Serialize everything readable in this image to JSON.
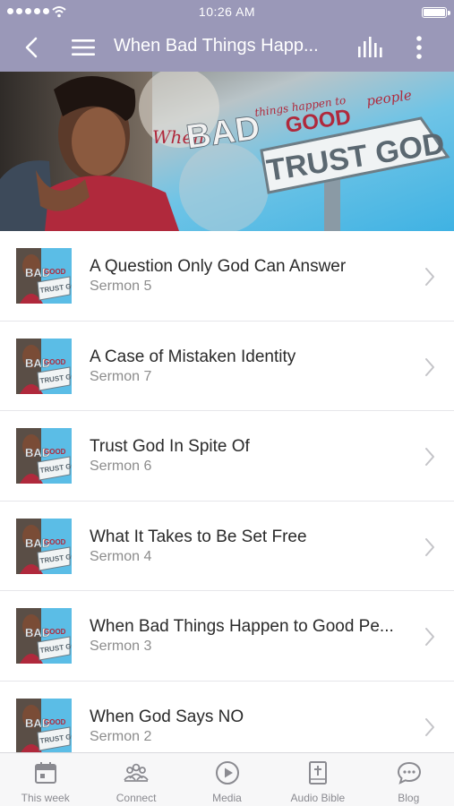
{
  "status_bar": {
    "time": "10:26 AM"
  },
  "header": {
    "title": "When Bad Things Happ..."
  },
  "banner": {
    "when": "When",
    "bad": "BAD",
    "things_happen": "things happen to",
    "good": "GOOD",
    "people": "people",
    "trust_god": "TRUST GOD"
  },
  "thumb": {
    "bad": "BAD",
    "good": "GOOD",
    "trust_god": "TRUST GOD"
  },
  "sermons": [
    {
      "title": "A Question Only God Can Answer",
      "subtitle": "Sermon 5"
    },
    {
      "title": "A Case of Mistaken Identity",
      "subtitle": "Sermon 7"
    },
    {
      "title": "Trust God In Spite Of",
      "subtitle": "Sermon 6"
    },
    {
      "title": "What It Takes to Be Set Free",
      "subtitle": "Sermon 4"
    },
    {
      "title": "When Bad Things Happen to Good Pe...",
      "subtitle": "Sermon 3"
    },
    {
      "title": "When God Says NO",
      "subtitle": "Sermon 2"
    }
  ],
  "tabs": [
    {
      "label": "This week",
      "icon": "calendar-icon"
    },
    {
      "label": "Connect",
      "icon": "people-icon"
    },
    {
      "label": "Media",
      "icon": "play-circle-icon"
    },
    {
      "label": "Audio Bible",
      "icon": "bible-icon"
    },
    {
      "label": "Blog",
      "icon": "chat-bubble-icon"
    }
  ],
  "colors": {
    "header_bg": "#9a98b8",
    "banner_title": "#f2f2f2",
    "banner_accent": "#b0293c",
    "tab_icon": "#8a8a90"
  }
}
